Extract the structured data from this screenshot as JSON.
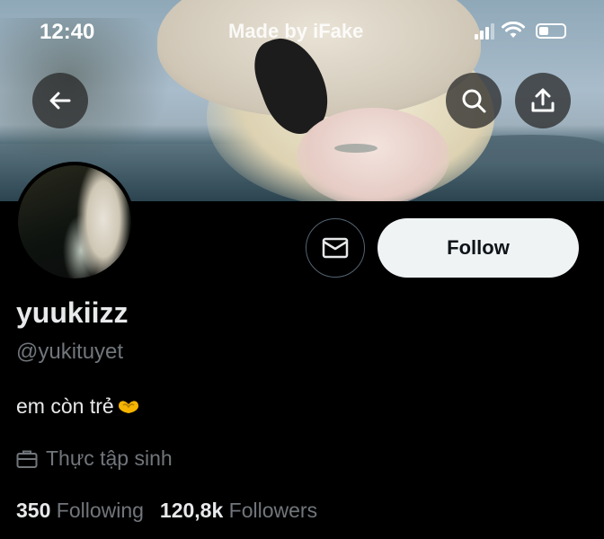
{
  "status_bar": {
    "time": "12:40",
    "watermark": "Made by iFake"
  },
  "profile": {
    "display_name": "yuukiizz",
    "handle": "@yukituyet",
    "bio": "em còn trẻ",
    "bio_emoji": "heart-hands-icon",
    "job": "Thực tập sinh",
    "following_count": "350",
    "following_label": "Following",
    "followers_count": "120,8k",
    "followers_label": "Followers"
  },
  "actions": {
    "follow_label": "Follow"
  },
  "icons": [
    "back-arrow-icon",
    "search-icon",
    "share-icon",
    "mail-icon",
    "briefcase-icon"
  ],
  "colors": {
    "background": "#000000",
    "muted_text": "#71767b",
    "follow_button_bg": "#eff3f4",
    "follow_button_text": "#0f1419",
    "emoji_yellow": "#f4b400"
  }
}
